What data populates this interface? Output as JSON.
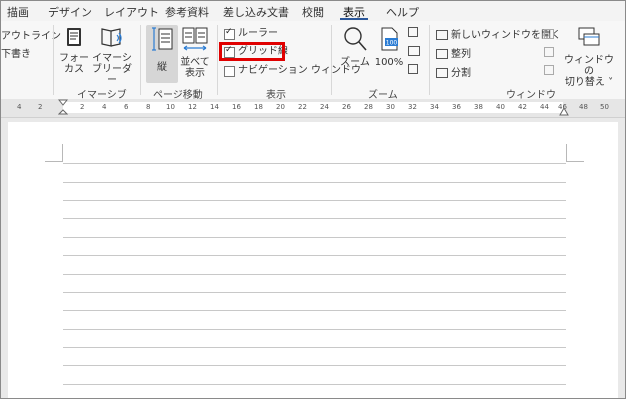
{
  "tabs": [
    "描画",
    "デザイン",
    "レイアウト",
    "参考資料",
    "差し込み文書",
    "校閲",
    "表示",
    "ヘルプ"
  ],
  "active_tab": "表示",
  "ribbon": {
    "views_partial": [
      "アウトライン",
      "下書き"
    ],
    "immersive": {
      "focus": [
        "フォー",
        "カス"
      ],
      "immersive_reader": [
        "イマーシ",
        "ブリーダー"
      ],
      "group": "イマーシブ"
    },
    "page_move": {
      "vertical": "縦",
      "side_by_side": [
        "並べて",
        "表示"
      ],
      "group": "ページ移動"
    },
    "show": {
      "ruler": "ルーラー",
      "gridlines": "グリッド線",
      "navigation": "ナビゲーション ウィンドウ",
      "ruler_checked": true,
      "gridlines_checked": true,
      "navigation_checked": false,
      "group": "表示"
    },
    "zoom": {
      "zoom": "ズーム",
      "hundred": "100%",
      "icon_100": "100",
      "group": "ズーム"
    },
    "window": {
      "new_window": "新しいウィンドウを開く",
      "arrange": "整列",
      "split": "分割",
      "switch": [
        "ウィンドウの",
        "切り替え ˅"
      ],
      "group": "ウィンドウ"
    }
  },
  "ruler_numbers": [
    "4",
    "2",
    "2",
    "4",
    "6",
    "8",
    "10",
    "12",
    "14",
    "16",
    "18",
    "20",
    "22",
    "24",
    "26",
    "28",
    "30",
    "32",
    "34",
    "36",
    "38",
    "40",
    "42",
    "44",
    "46",
    "48",
    "50"
  ],
  "highlight_color": "#e00000"
}
